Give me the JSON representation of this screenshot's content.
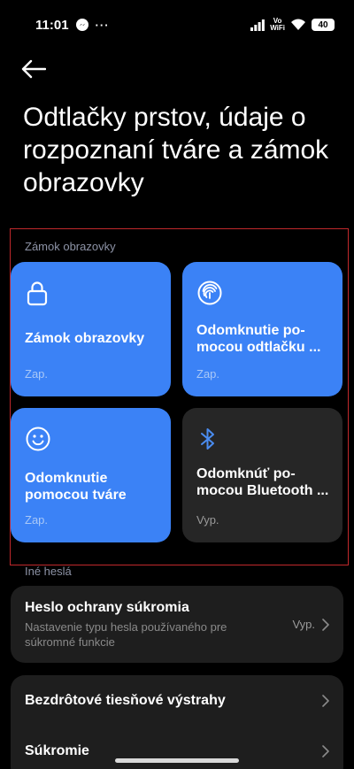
{
  "status_bar": {
    "time": "11:01",
    "dots": "···",
    "vowifi_top": "Vo",
    "vowifi_bottom": "WiFi",
    "battery": "40"
  },
  "header": {
    "title": "Odtlačky prstov, údaje o rozpoznaní tváre a zámok obrazovky"
  },
  "lock_section": {
    "label": "Zámok obrazovky",
    "tiles": [
      {
        "title": "Zámok obrazovky",
        "status": "Zap.",
        "icon": "lock-icon",
        "state": "on"
      },
      {
        "title": "Odomknutie po-mocou odtlačku ...",
        "status": "Zap.",
        "icon": "fingerprint-icon",
        "state": "on"
      },
      {
        "title": "Odomknutie pomocou tváre",
        "status": "Zap.",
        "icon": "face-icon",
        "state": "on"
      },
      {
        "title": "Odomknúť po-mocou Bluetooth ...",
        "status": "Vyp.",
        "icon": "bluetooth-icon",
        "state": "off"
      }
    ]
  },
  "other_passwords": {
    "label": "Iné heslá",
    "privacy_password": {
      "title": "Heslo ochrany súkromia",
      "subtitle": "Nastavenie typu hesla používaného pre súkromné funkcie",
      "value": "Vyp."
    }
  },
  "more": {
    "items": [
      {
        "title": "Bezdrôtové tiesňové výstrahy"
      },
      {
        "title": "Súkromie"
      }
    ]
  },
  "colors": {
    "accent": "#3b82f6",
    "tile_off": "#262626",
    "card_bg": "#1e1e1e",
    "highlight_border": "#c0282b"
  }
}
